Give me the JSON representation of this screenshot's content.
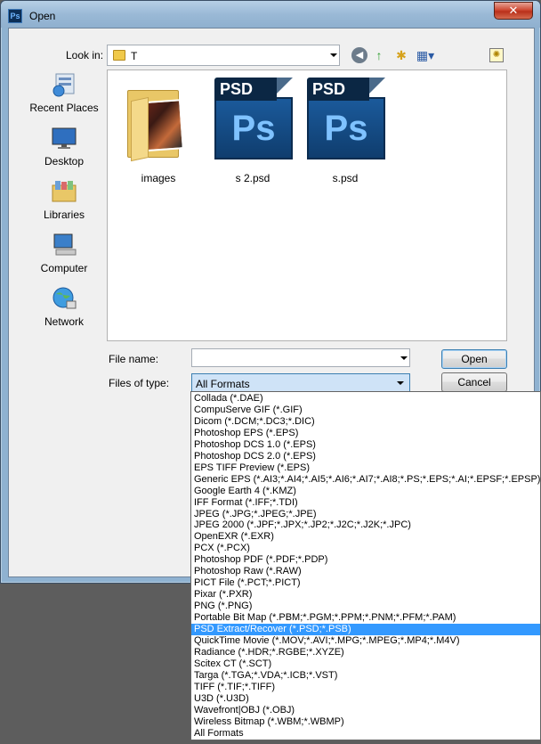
{
  "window": {
    "title": "Open",
    "app_icon_text": "Ps",
    "close_glyph": "✕"
  },
  "toolbar": {
    "look_in_label": "Look in:",
    "look_in_value": "T",
    "icons": [
      "back-icon",
      "up-folder-icon",
      "new-folder-icon",
      "views-menu-icon",
      "desktop-shortcut-icon"
    ]
  },
  "places": [
    {
      "label": "Recent Places",
      "icon": "recent-places-icon"
    },
    {
      "label": "Desktop",
      "icon": "desktop-icon"
    },
    {
      "label": "Libraries",
      "icon": "libraries-icon"
    },
    {
      "label": "Computer",
      "icon": "computer-icon"
    },
    {
      "label": "Network",
      "icon": "network-icon"
    }
  ],
  "files": [
    {
      "name": "images",
      "type": "folder"
    },
    {
      "name": "s 2.psd",
      "type": "psd",
      "badge": "PSD",
      "logo": "Ps"
    },
    {
      "name": "s.psd",
      "type": "psd",
      "badge": "PSD",
      "logo": "Ps"
    }
  ],
  "form": {
    "file_name_label": "File name:",
    "file_name_value": "",
    "files_of_type_label": "Files of type:",
    "files_of_type_value": "All Formats",
    "open_label": "Open",
    "cancel_label": "Cancel"
  },
  "format_options": [
    "Collada (*.DAE)",
    "CompuServe GIF (*.GIF)",
    "Dicom (*.DCM;*.DC3;*.DIC)",
    "Photoshop EPS (*.EPS)",
    "Photoshop DCS 1.0 (*.EPS)",
    "Photoshop DCS 2.0 (*.EPS)",
    "EPS TIFF Preview (*.EPS)",
    "Generic EPS (*.AI3;*.AI4;*.AI5;*.AI6;*.AI7;*.AI8;*.PS;*.EPS;*.AI;*.EPSF;*.EPSP)",
    "Google Earth 4 (*.KMZ)",
    "IFF Format (*.IFF;*.TDI)",
    "JPEG (*.JPG;*.JPEG;*.JPE)",
    "JPEG 2000 (*.JPF;*.JPX;*.JP2;*.J2C;*.J2K;*.JPC)",
    "OpenEXR (*.EXR)",
    "PCX (*.PCX)",
    "Photoshop PDF (*.PDF;*.PDP)",
    "Photoshop Raw (*.RAW)",
    "PICT File (*.PCT;*.PICT)",
    "Pixar (*.PXR)",
    "PNG (*.PNG)",
    "Portable Bit Map (*.PBM;*.PGM;*.PPM;*.PNM;*.PFM;*.PAM)",
    "PSD Extract/Recover (*.PSD;*.PSB)",
    "QuickTime Movie (*.MOV;*.AVI;*.MPG;*.MPEG;*.MP4;*.M4V)",
    "Radiance (*.HDR;*.RGBE;*.XYZE)",
    "Scitex CT (*.SCT)",
    "Targa (*.TGA;*.VDA;*.ICB;*.VST)",
    "TIFF (*.TIF;*.TIFF)",
    "U3D (*.U3D)",
    "Wavefront|OBJ (*.OBJ)",
    "Wireless Bitmap (*.WBM;*.WBMP)",
    "All Formats"
  ],
  "selected_option_index": 20,
  "colors": {
    "selection": "#3399ff",
    "frame": "#8fb2d1",
    "close": "#cf4a34"
  }
}
